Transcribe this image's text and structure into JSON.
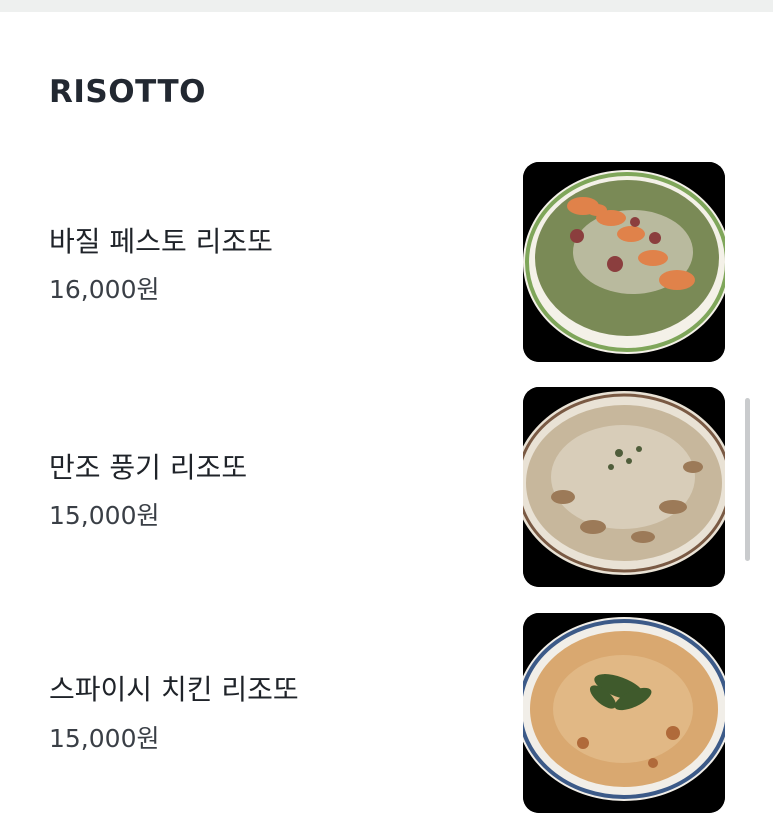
{
  "section": {
    "title": "RISOTTO"
  },
  "items": [
    {
      "name": "바질 페스토 리조또",
      "price": "16,000원",
      "image_icon": "basil-pesto-risotto-photo"
    },
    {
      "name": "만조 풍기 리조또",
      "price": "15,000원",
      "image_icon": "funghi-risotto-photo"
    },
    {
      "name": "스파이시 치킨 리조또",
      "price": "15,000원",
      "image_icon": "spicy-chicken-risotto-photo"
    }
  ],
  "colors": {
    "text_primary": "#1f2329",
    "background": "#ffffff",
    "image_background": "#000000"
  }
}
